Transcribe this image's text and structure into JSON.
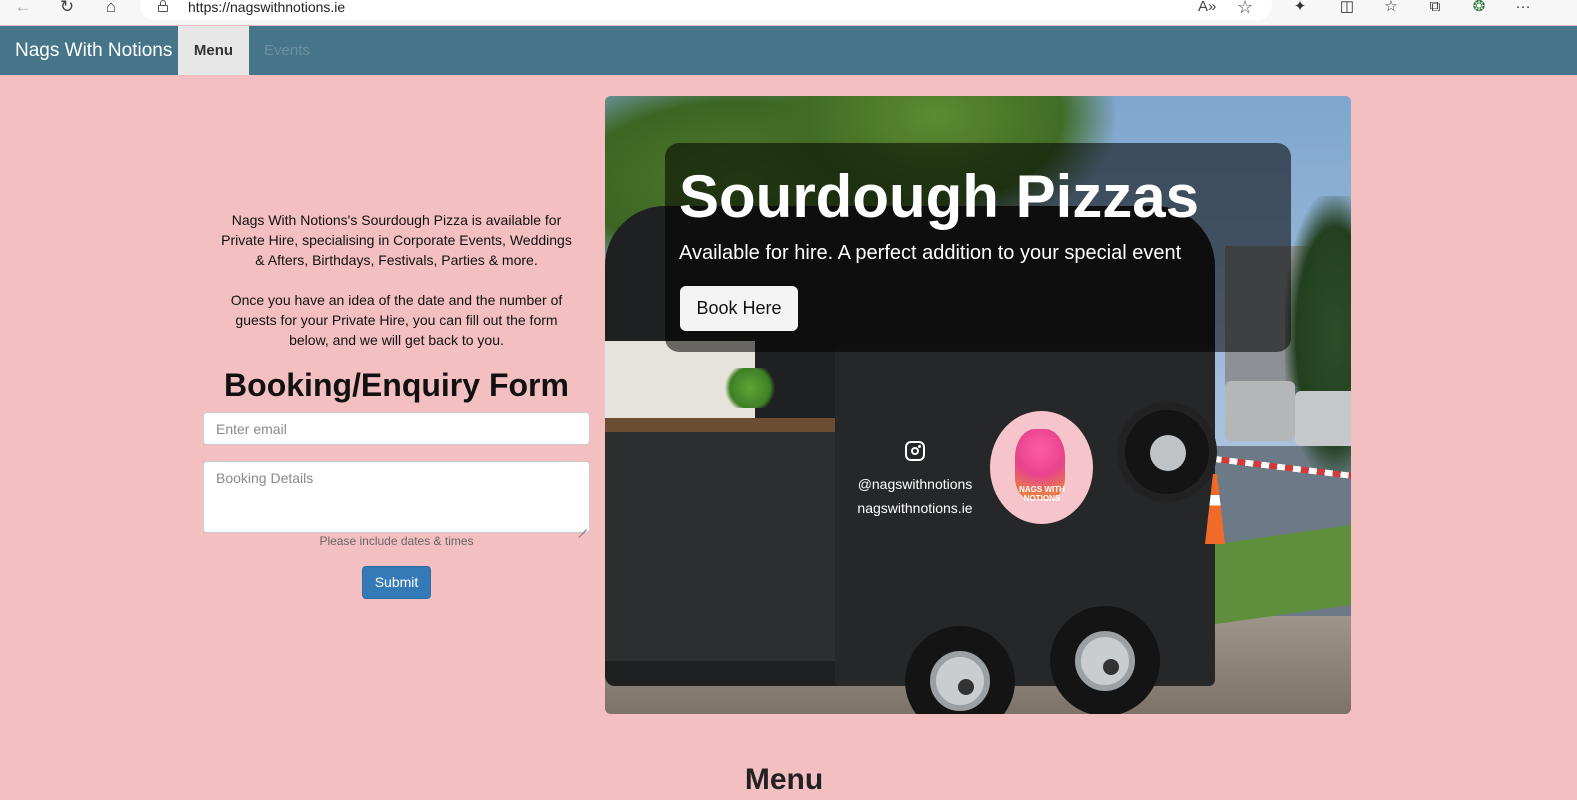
{
  "browser": {
    "url": "https://nagswithnotions.ie",
    "icons": [
      "back-icon",
      "reload-icon",
      "home-icon",
      "lock-icon",
      "read-aloud-icon",
      "favorite-star-icon",
      "extensions-icon",
      "split-screen-icon",
      "favorites-icon",
      "collections-icon",
      "performance-icon",
      "more-icon"
    ],
    "glyphs": {
      "back": "←",
      "reload": "↻",
      "home": "⌂",
      "read_aloud": "A»",
      "favorite": "☆",
      "extensions": "✦",
      "split": "◫",
      "favorites": "☆",
      "collections": "⧉",
      "performance": "❂",
      "more": "···"
    }
  },
  "navbar": {
    "brand": "Nags With Notions",
    "items": [
      {
        "label": "Menu",
        "active": true
      },
      {
        "label": "Events",
        "active": false
      }
    ],
    "bg_color": "#467589",
    "active_bg": "#e7e7e7"
  },
  "intro": {
    "paragraph1": "Nags With Notions's Sourdough Pizza is available for Private Hire, specialising in Corporate Events, Weddings & Afters, Birthdays, Festivals, Parties & more.",
    "paragraph2": "Once you have an idea of the date and the number of guests for your Private Hire, you can fill out the form below, and we will get back to you."
  },
  "form": {
    "title": "Booking/Enquiry Form",
    "email_placeholder": "Enter email",
    "email_value": "",
    "details_placeholder": "Booking Details",
    "details_value": "",
    "help_text": "Please include dates & times",
    "submit_label": "Submit",
    "submit_color": "#337ab7"
  },
  "hero": {
    "title": "Sourdough Pizzas",
    "subtitle": "Available for hire. A perfect addition to your special event",
    "button_label": "Book Here",
    "image_text": {
      "handle": "@nagswithnotions",
      "website": "nagswithnotions.ie",
      "logo_text": "NAGS WITH NOTIONS"
    }
  },
  "sections": {
    "menu_heading": "Menu"
  },
  "colors": {
    "page_bg": "#f3bfc1"
  }
}
